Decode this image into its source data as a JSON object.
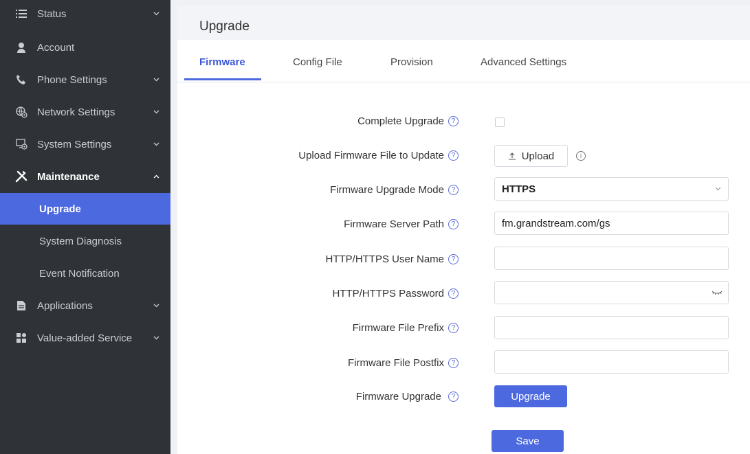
{
  "sidebar": {
    "items": [
      {
        "label": "Status",
        "icon": "list-icon",
        "chevron": "⌄"
      },
      {
        "label": "Account",
        "icon": "person-icon",
        "chevron": ""
      },
      {
        "label": "Phone Settings",
        "icon": "phone-icon",
        "chevron": "⌄"
      },
      {
        "label": "Network Settings",
        "icon": "network-gear-icon",
        "chevron": "⌄"
      },
      {
        "label": "System Settings",
        "icon": "monitor-gear-icon",
        "chevron": "⌄"
      },
      {
        "label": "Maintenance",
        "icon": "tools-icon",
        "chevron": "⌃"
      },
      {
        "label": "Applications",
        "icon": "document-icon",
        "chevron": "⌄"
      },
      {
        "label": "Value-added Service",
        "icon": "grid-icon",
        "chevron": "⌄"
      }
    ],
    "sub_items": [
      {
        "label": "Upgrade"
      },
      {
        "label": "System Diagnosis"
      },
      {
        "label": "Event Notification"
      }
    ]
  },
  "page": {
    "title": "Upgrade"
  },
  "tabs": [
    {
      "label": "Firmware"
    },
    {
      "label": "Config File"
    },
    {
      "label": "Provision"
    },
    {
      "label": "Advanced Settings"
    }
  ],
  "form": {
    "complete_upgrade_label": "Complete Upgrade",
    "complete_upgrade_checked": false,
    "upload_label": "Upload Firmware File to Update",
    "upload_button": "Upload",
    "upgrade_mode_label": "Firmware Upgrade Mode",
    "upgrade_mode_value": "HTTPS",
    "server_path_label": "Firmware Server Path",
    "server_path_value": "fm.grandstream.com/gs",
    "user_name_label": "HTTP/HTTPS User Name",
    "user_name_value": "",
    "password_label": "HTTP/HTTPS Password",
    "password_value": "",
    "prefix_label": "Firmware File Prefix",
    "prefix_value": "",
    "postfix_label": "Firmware File Postfix",
    "postfix_value": "",
    "firmware_upgrade_label": "Firmware Upgrade",
    "upgrade_button": "Upgrade",
    "save_button": "Save"
  },
  "colors": {
    "accent": "#4c69e0",
    "sidebar_bg": "#2f3338",
    "active_tab": "#3b57d6"
  }
}
